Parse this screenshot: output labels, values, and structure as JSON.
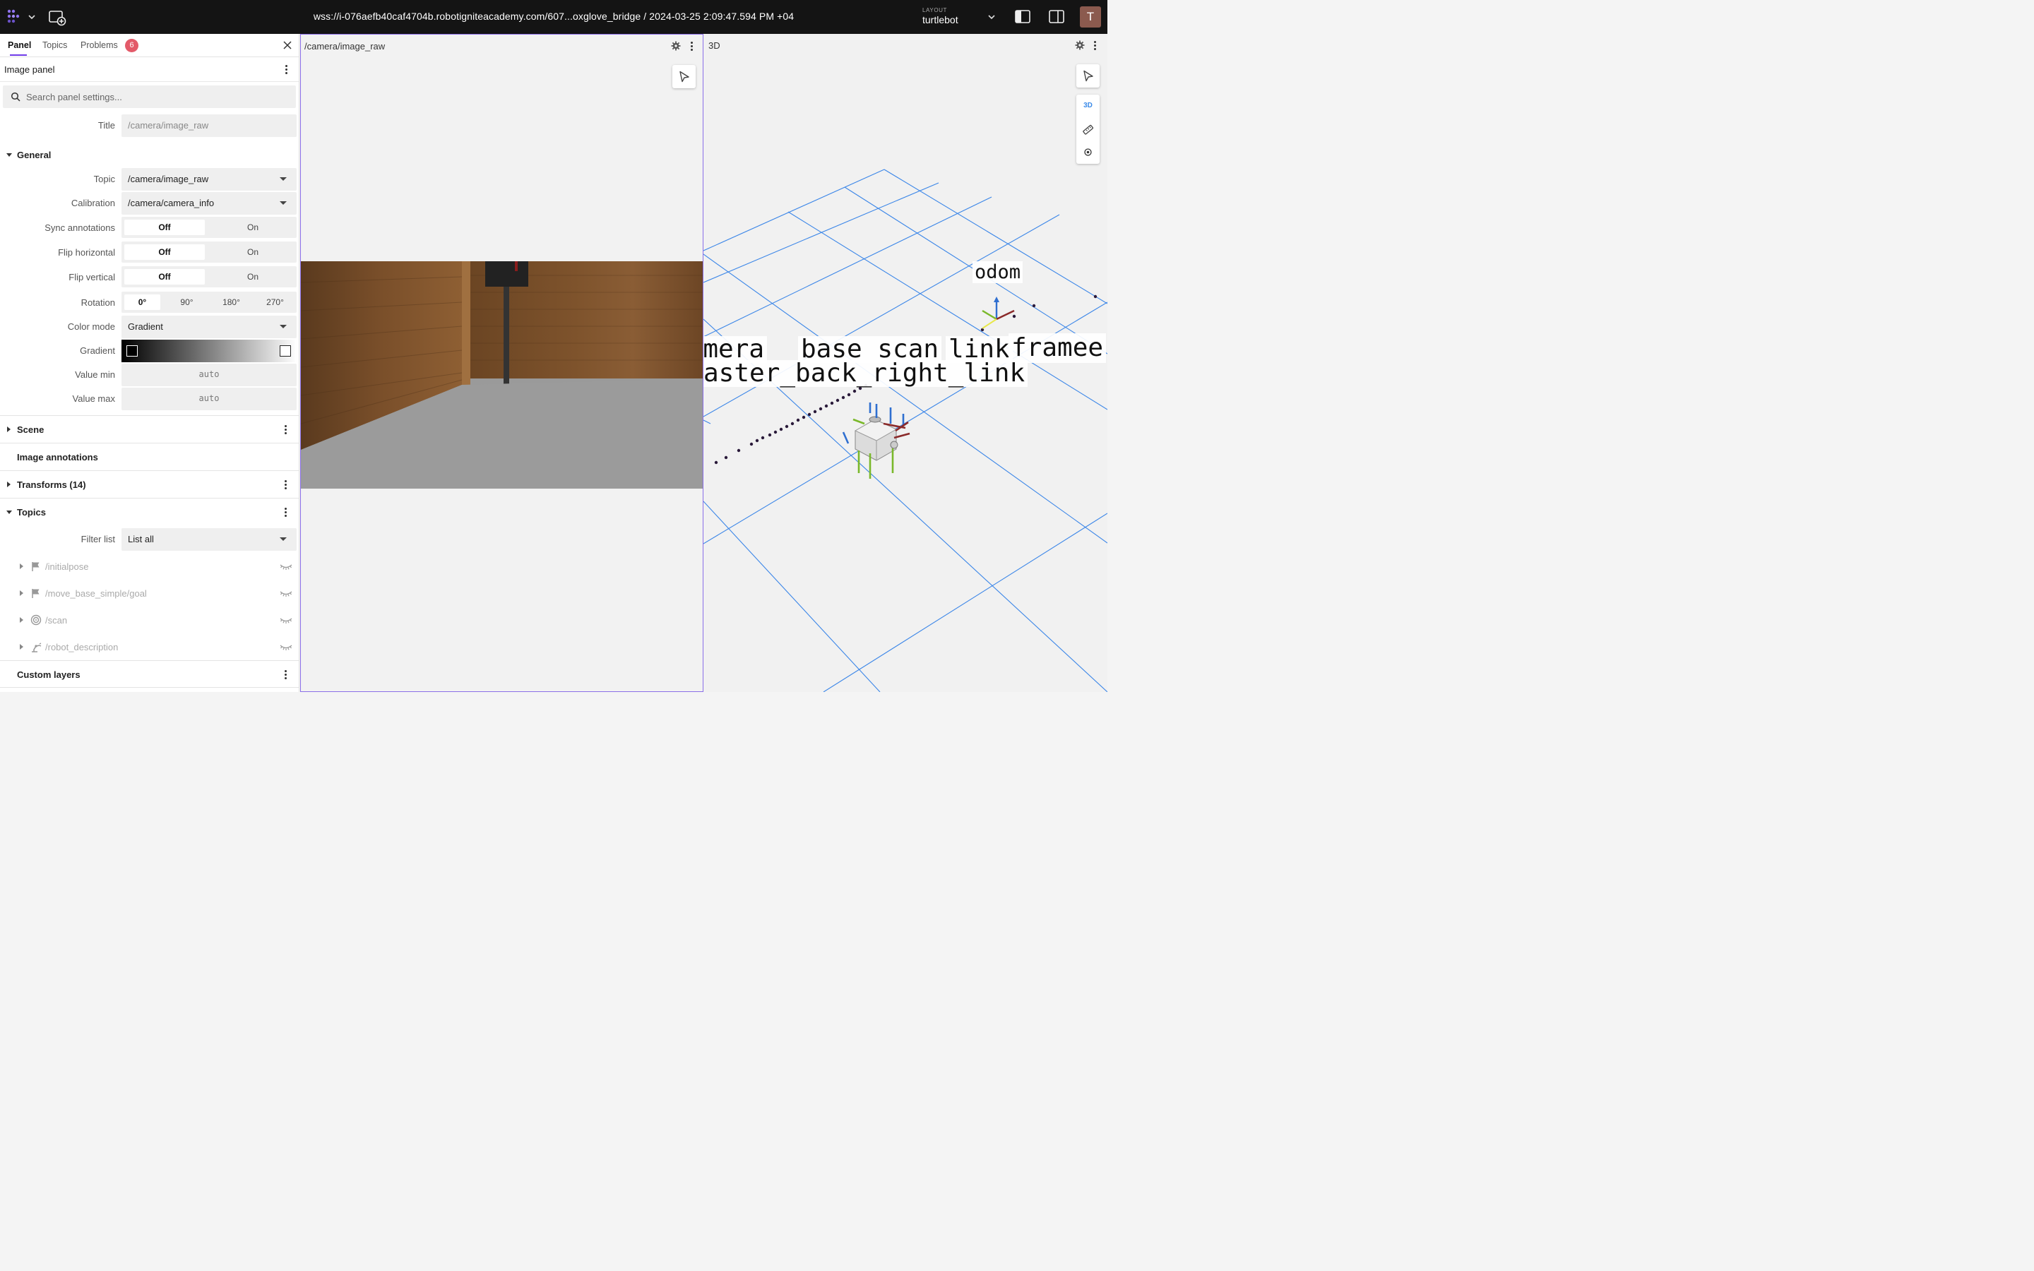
{
  "topbar": {
    "url": "wss://i-076aefb40caf4704b.robotigniteacademy.com/607...oxglove_bridge / 2024-03-25 2:09:47.594 PM +04",
    "layout_label": "LAYOUT",
    "layout_name": "turtlebot",
    "avatar_initial": "T"
  },
  "sidebar": {
    "tabs": [
      {
        "label": "Panel",
        "active": true
      },
      {
        "label": "Topics"
      },
      {
        "label": "Problems"
      }
    ],
    "problems_count": "6",
    "panel_title": "Image panel",
    "search_placeholder": "Search panel settings...",
    "title_label": "Title",
    "title_placeholder": "/camera/image_raw",
    "general": {
      "heading": "General",
      "topic_label": "Topic",
      "topic_value": "/camera/image_raw",
      "calibration_label": "Calibration",
      "calibration_value": "/camera/camera_info",
      "sync_label": "Sync annotations",
      "flip_h_label": "Flip horizontal",
      "flip_v_label": "Flip vertical",
      "off": "Off",
      "on": "On",
      "rotation_label": "Rotation",
      "rotation_options": [
        "0°",
        "90°",
        "180°",
        "270°"
      ],
      "color_mode_label": "Color mode",
      "color_mode_value": "Gradient",
      "gradient_label": "Gradient",
      "gradient_start": "#000000",
      "gradient_end": "#ffffff",
      "value_min_label": "Value min",
      "value_max_label": "Value max",
      "auto": "auto"
    },
    "sections": {
      "scene": "Scene",
      "image_annotations": "Image annotations",
      "transforms": "Transforms (14)",
      "topics": "Topics",
      "custom_layers": "Custom layers"
    },
    "topics": {
      "filter_label": "Filter list",
      "filter_value": "List all",
      "items": [
        {
          "name": "/initialpose",
          "icon": "flag-icon"
        },
        {
          "name": "/move_base_simple/goal",
          "icon": "flag-icon"
        },
        {
          "name": "/scan",
          "icon": "radar-icon"
        },
        {
          "name": "/robot_description",
          "icon": "robot-arm-icon"
        }
      ]
    }
  },
  "image_panel": {
    "title": "/camera/image_raw"
  },
  "threed_panel": {
    "title": "3D",
    "mode_button": "3D",
    "frame_labels": {
      "odom": "odom",
      "camera": "camera",
      "base_scan": "base scan",
      "link": "link",
      "frame": "framee",
      "caster": "aster_back_right_link"
    }
  },
  "colors": {
    "accent": "#6f3be8",
    "badge": "#e35a69",
    "grid": "#3b86e8",
    "panel_border": "#8a6ee8"
  }
}
